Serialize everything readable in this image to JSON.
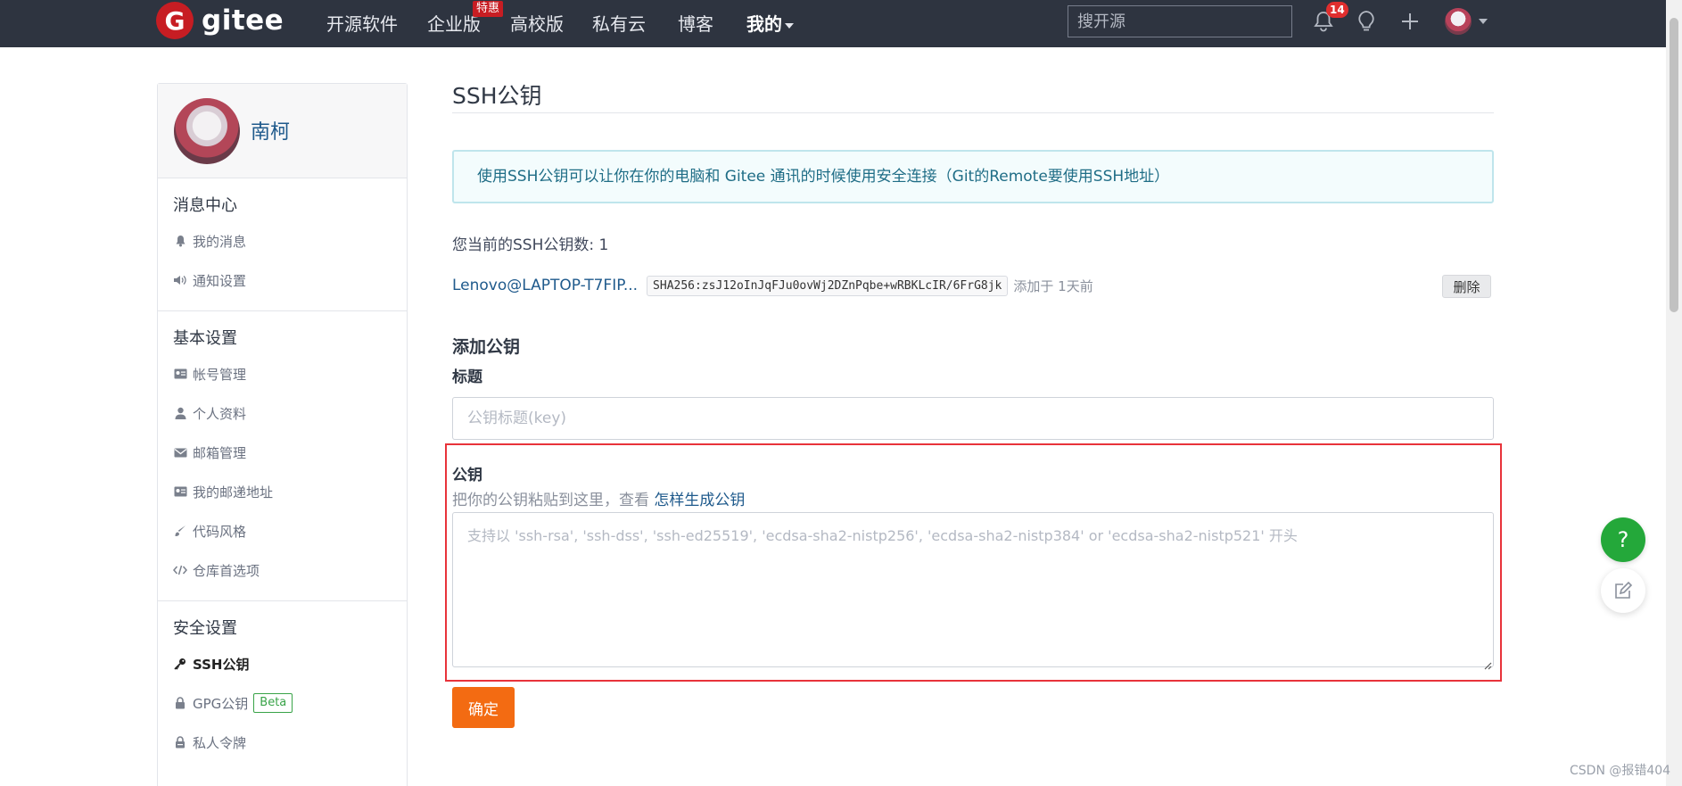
{
  "nav": {
    "logo_letter": "G",
    "logo_text": "gitee",
    "links": [
      "开源软件",
      "企业版",
      "高校版",
      "私有云",
      "博客"
    ],
    "enterprise_badge": "特惠",
    "mine": "我的",
    "search_placeholder": "搜开源",
    "notification_count": "14"
  },
  "sidebar": {
    "username": "南柯",
    "sections": [
      {
        "title": "消息中心",
        "items": [
          "我的消息",
          "通知设置"
        ]
      },
      {
        "title": "基本设置",
        "items": [
          "帐号管理",
          "个人资料",
          "邮箱管理",
          "我的邮递地址",
          "代码风格",
          "仓库首选项"
        ]
      },
      {
        "title": "安全设置",
        "items": [
          "SSH公钥",
          "GPG公钥",
          "私人令牌"
        ]
      }
    ],
    "beta_label": "Beta"
  },
  "main": {
    "page_title": "SSH公钥",
    "info": "使用SSH公钥可以让你在你的电脑和 Gitee 通讯的时候使用安全连接（Git的Remote要使用SSH地址）",
    "count_label": "您当前的SSH公钥数: 1",
    "key": {
      "name": "Lenovo@LAPTOP-T7FIP...",
      "fingerprint": "SHA256:zsJ12oInJqFJu0ovWj2DZnPqbe+wRBKLcIR/6FrG8jk",
      "added": "添加于 1天前",
      "delete_label": "删除"
    },
    "add_title": "添加公钥",
    "title_label": "标题",
    "title_placeholder": "公钥标题(key)",
    "key_label": "公钥",
    "help_text": "把你的公钥粘贴到这里，查看 ",
    "help_link": "怎样生成公钥",
    "key_placeholder": "支持以 'ssh-rsa', 'ssh-dss', 'ssh-ed25519', 'ecdsa-sha2-nistp256', 'ecdsa-sha2-nistp384' or 'ecdsa-sha2-nistp521' 开头",
    "submit_label": "确定"
  },
  "floating": {
    "help_symbol": "?"
  },
  "watermark": "CSDN @报错404",
  "colors": {
    "nav_bg": "#2e3440",
    "brand_red": "#c71d23",
    "submit_orange": "#f36b12",
    "highlight_red": "#e8333a",
    "help_green": "#24a83a"
  }
}
